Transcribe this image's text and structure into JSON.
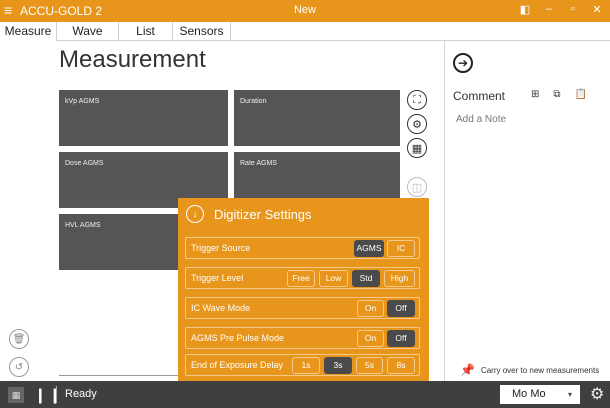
{
  "titlebar": {
    "app_title": "ACCU-GOLD 2",
    "document_title": "New",
    "colors": {
      "accent": "#e8951c"
    }
  },
  "tabs": [
    {
      "label": "Measure",
      "active": true
    },
    {
      "label": "Wave",
      "active": false
    },
    {
      "label": "List",
      "active": false
    },
    {
      "label": "Sensors",
      "active": false
    }
  ],
  "main": {
    "heading": "Measurement",
    "tiles": [
      {
        "label": "kVp AGMS"
      },
      {
        "label": "Duration"
      },
      {
        "label": "Dose AGMS"
      },
      {
        "label": "Rate AGMS"
      },
      {
        "label": "HVL AGMS"
      }
    ]
  },
  "right_panel": {
    "comment_title": "Comment",
    "note_placeholder": "Add a Note",
    "carry_over": "Carry over to new measurements"
  },
  "digitizer": {
    "title": "Digitizer Settings",
    "rows": [
      {
        "label": "Trigger Source",
        "options": [
          "AGMS",
          "IC"
        ],
        "selected": "AGMS"
      },
      {
        "label": "Trigger Level",
        "options": [
          "Free",
          "Low",
          "Std",
          "High"
        ],
        "selected": "Std"
      },
      {
        "label": "IC Wave Mode",
        "options": [
          "On",
          "Off"
        ],
        "selected": "Off"
      },
      {
        "label": "AGMS Pre Pulse Mode",
        "options": [
          "On",
          "Off"
        ],
        "selected": "Off"
      },
      {
        "label": "End of Exposure Delay",
        "options": [
          "1s",
          "3s",
          "5s",
          "8s"
        ],
        "selected": "3s"
      }
    ]
  },
  "status": {
    "text": "Ready",
    "dropdown_value": "Mo Mo"
  }
}
